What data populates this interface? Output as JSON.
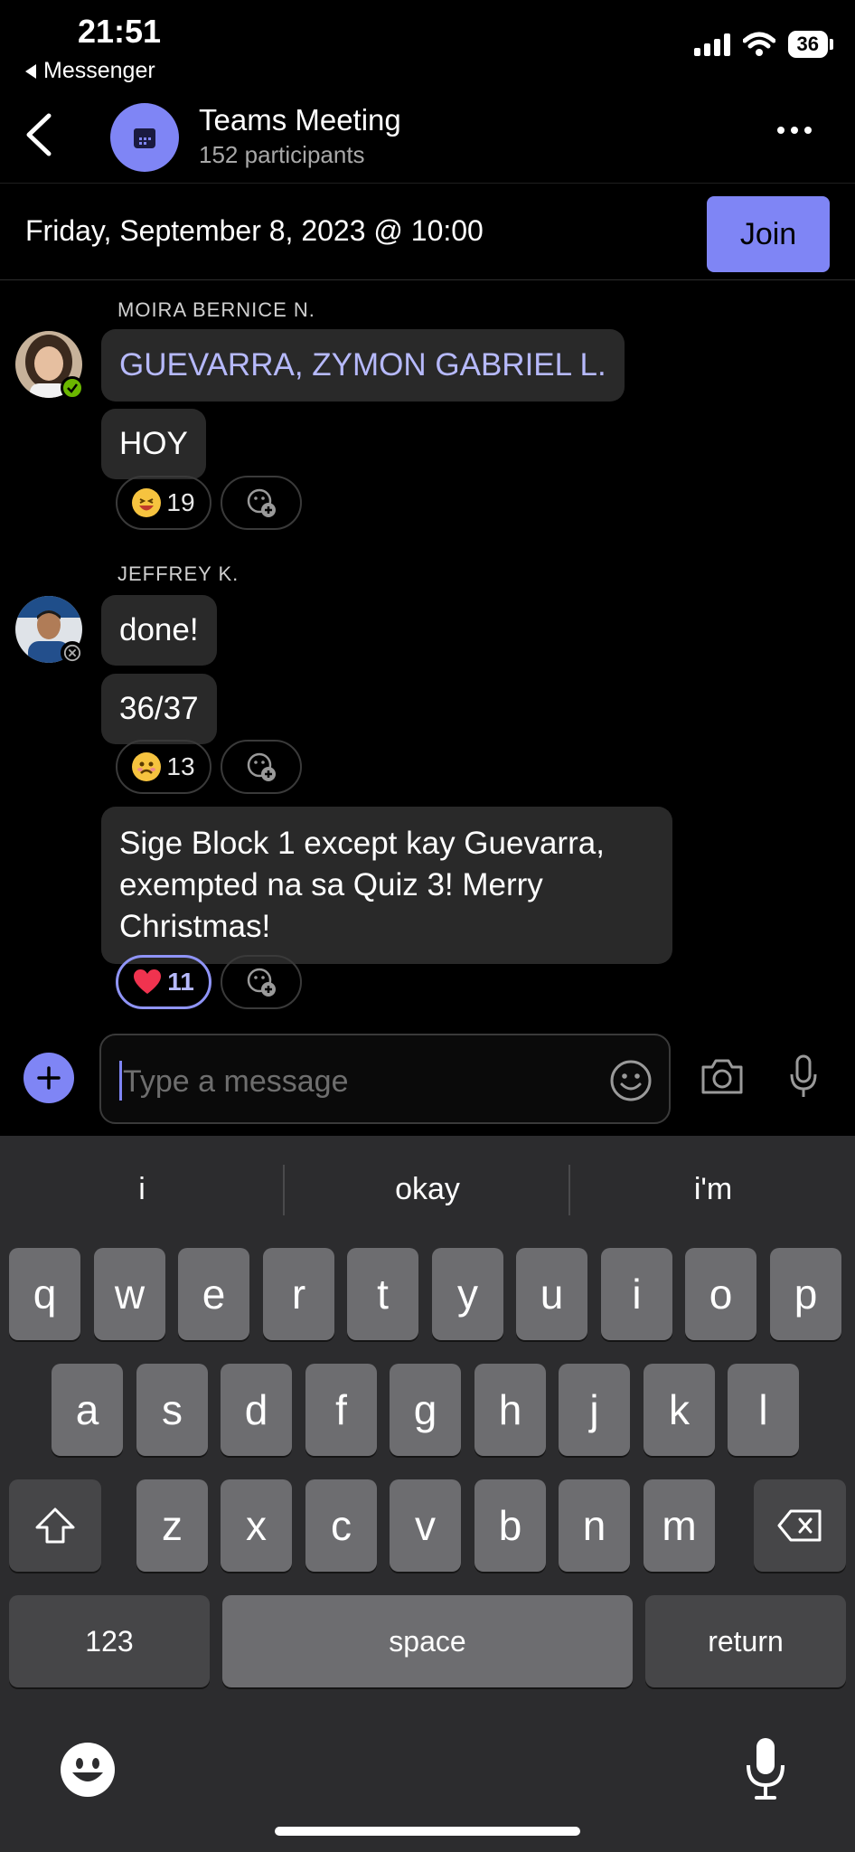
{
  "status_bar": {
    "time": "21:51",
    "back_app": "Messenger",
    "battery": "36"
  },
  "header": {
    "title": "Teams Meeting",
    "subtitle": "152 participants"
  },
  "meeting": {
    "date": "Friday, September 8, 2023 @ 10:00",
    "join_label": "Join"
  },
  "messages": [
    {
      "sender": "MOIRA BERNICE N.",
      "bubbles": [
        "GUEVARRA, ZYMON GABRIEL L.",
        "HOY"
      ],
      "reaction_count": "19"
    },
    {
      "sender": "JEFFREY K.",
      "bubbles": [
        "done!",
        "36/37",
        "Sige Block 1 except kay Guevarra, exempted na sa Quiz 3! Merry Christmas!"
      ],
      "reaction_counts": [
        "13",
        "11"
      ]
    }
  ],
  "compose": {
    "placeholder": "Type a message"
  },
  "keyboard": {
    "suggestions": [
      "i",
      "okay",
      "i'm"
    ],
    "row1": [
      "q",
      "w",
      "e",
      "r",
      "t",
      "y",
      "u",
      "i",
      "o",
      "p"
    ],
    "row2": [
      "a",
      "s",
      "d",
      "f",
      "g",
      "h",
      "j",
      "k",
      "l"
    ],
    "row3": [
      "z",
      "x",
      "c",
      "v",
      "b",
      "n",
      "m"
    ],
    "numbers_label": "123",
    "space_label": "space",
    "return_label": "return"
  },
  "colors": {
    "accent": "#7f85f5",
    "mention": "#b6b9fb",
    "bubble": "#292929",
    "keyboard_bg": "#2c2c2e",
    "key": "#6d6d70"
  },
  "icons": {
    "presence_available": "check-circle-icon",
    "presence_offline": "x-circle-icon",
    "meeting": "calendar-icon"
  }
}
